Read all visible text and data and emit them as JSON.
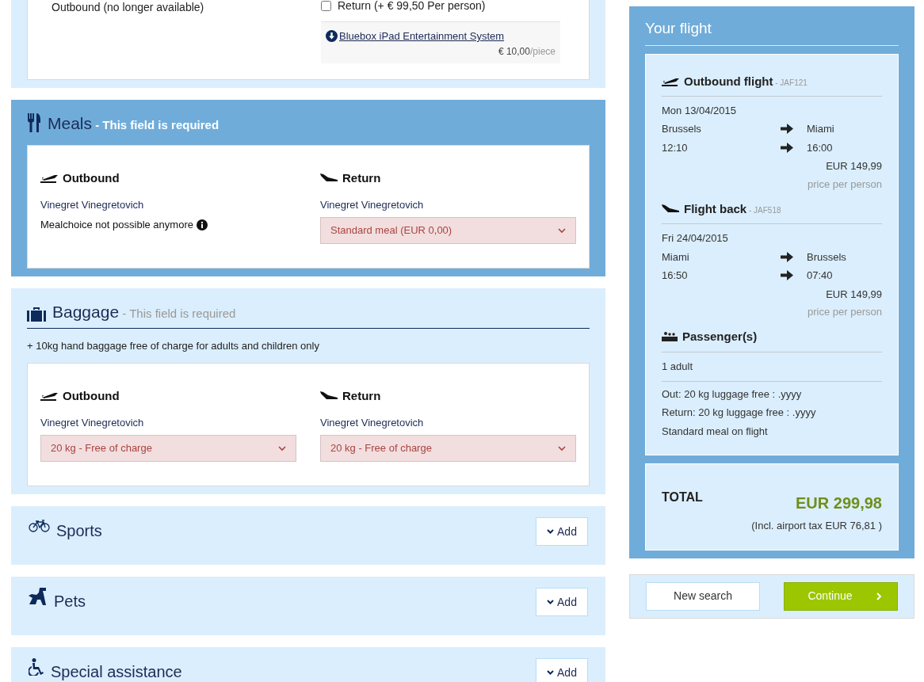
{
  "sections": [
    {
      "kind": "entertainment",
      "highlighted": false,
      "outbound_note": "Outbound (no longer available)",
      "return_option": {
        "label": "Return (+ € 99,50 Per person)",
        "checked": false
      },
      "product": {
        "link": "Bluebox iPad Entertainment System",
        "price": "€ 10,00",
        "unit": "/piece"
      }
    },
    {
      "kind": "meals",
      "highlighted": true,
      "title": "Meals",
      "required": " - This field is required",
      "legs": [
        {
          "kind": "outbound",
          "label": "Outbound",
          "passenger": "Vinegret Vinegretovich",
          "note": "Mealchoice not possible anymore"
        },
        {
          "kind": "return",
          "label": "Return",
          "passenger": "Vinegret Vinegretovich",
          "select": "Standard meal (EUR 0,00)"
        }
      ]
    },
    {
      "kind": "baggage",
      "highlighted": false,
      "title": "Baggage",
      "required": " - This field is required",
      "info": "+ 10kg hand baggage free of charge for adults and children only",
      "legs": [
        {
          "kind": "outbound",
          "label": "Outbound",
          "passenger": "Vinegret Vinegretovich",
          "select": "20 kg - Free of charge"
        },
        {
          "kind": "return",
          "label": "Return",
          "passenger": "Vinegret Vinegretovich",
          "select": "20 kg - Free of charge"
        }
      ]
    },
    {
      "kind": "sports",
      "highlighted": false,
      "title": "Sports",
      "button": "Add"
    },
    {
      "kind": "pets",
      "highlighted": false,
      "title": "Pets",
      "button": "Add"
    },
    {
      "kind": "assistance",
      "highlighted": false,
      "title": "Special assistance",
      "button": "Add"
    }
  ],
  "summary": {
    "title": "Your flight",
    "flights": [
      {
        "kind": "outbound",
        "title": "Outbound flight",
        "code": " - JAF121",
        "date": "Mon 13/04/2015",
        "from": "Brussels",
        "to": "Miami",
        "departure": "12:10",
        "arrival": "16:00",
        "price": "EUR 149,99",
        "price_note": "price per person"
      },
      {
        "kind": "return",
        "title": "Flight back",
        "code": " - JAF518",
        "date": "Fri 24/04/2015",
        "from": "Miami",
        "to": "Brussels",
        "departure": "16:50",
        "arrival": "07:40",
        "price": "EUR 149,99",
        "price_note": "price per person"
      }
    ],
    "passengers": {
      "title": "Passenger(s)",
      "count": "1 adult",
      "extras": [
        "Out: 20 kg luggage free : .yyyy",
        "Return: 20 kg luggage free : .yyyy",
        "Standard meal on flight"
      ]
    },
    "total": {
      "label": "TOTAL",
      "amount": "EUR 299,98",
      "tax": "(Incl. airport tax EUR 76,81 )"
    }
  },
  "actions": {
    "new_search": "New search",
    "continue": "Continue"
  }
}
